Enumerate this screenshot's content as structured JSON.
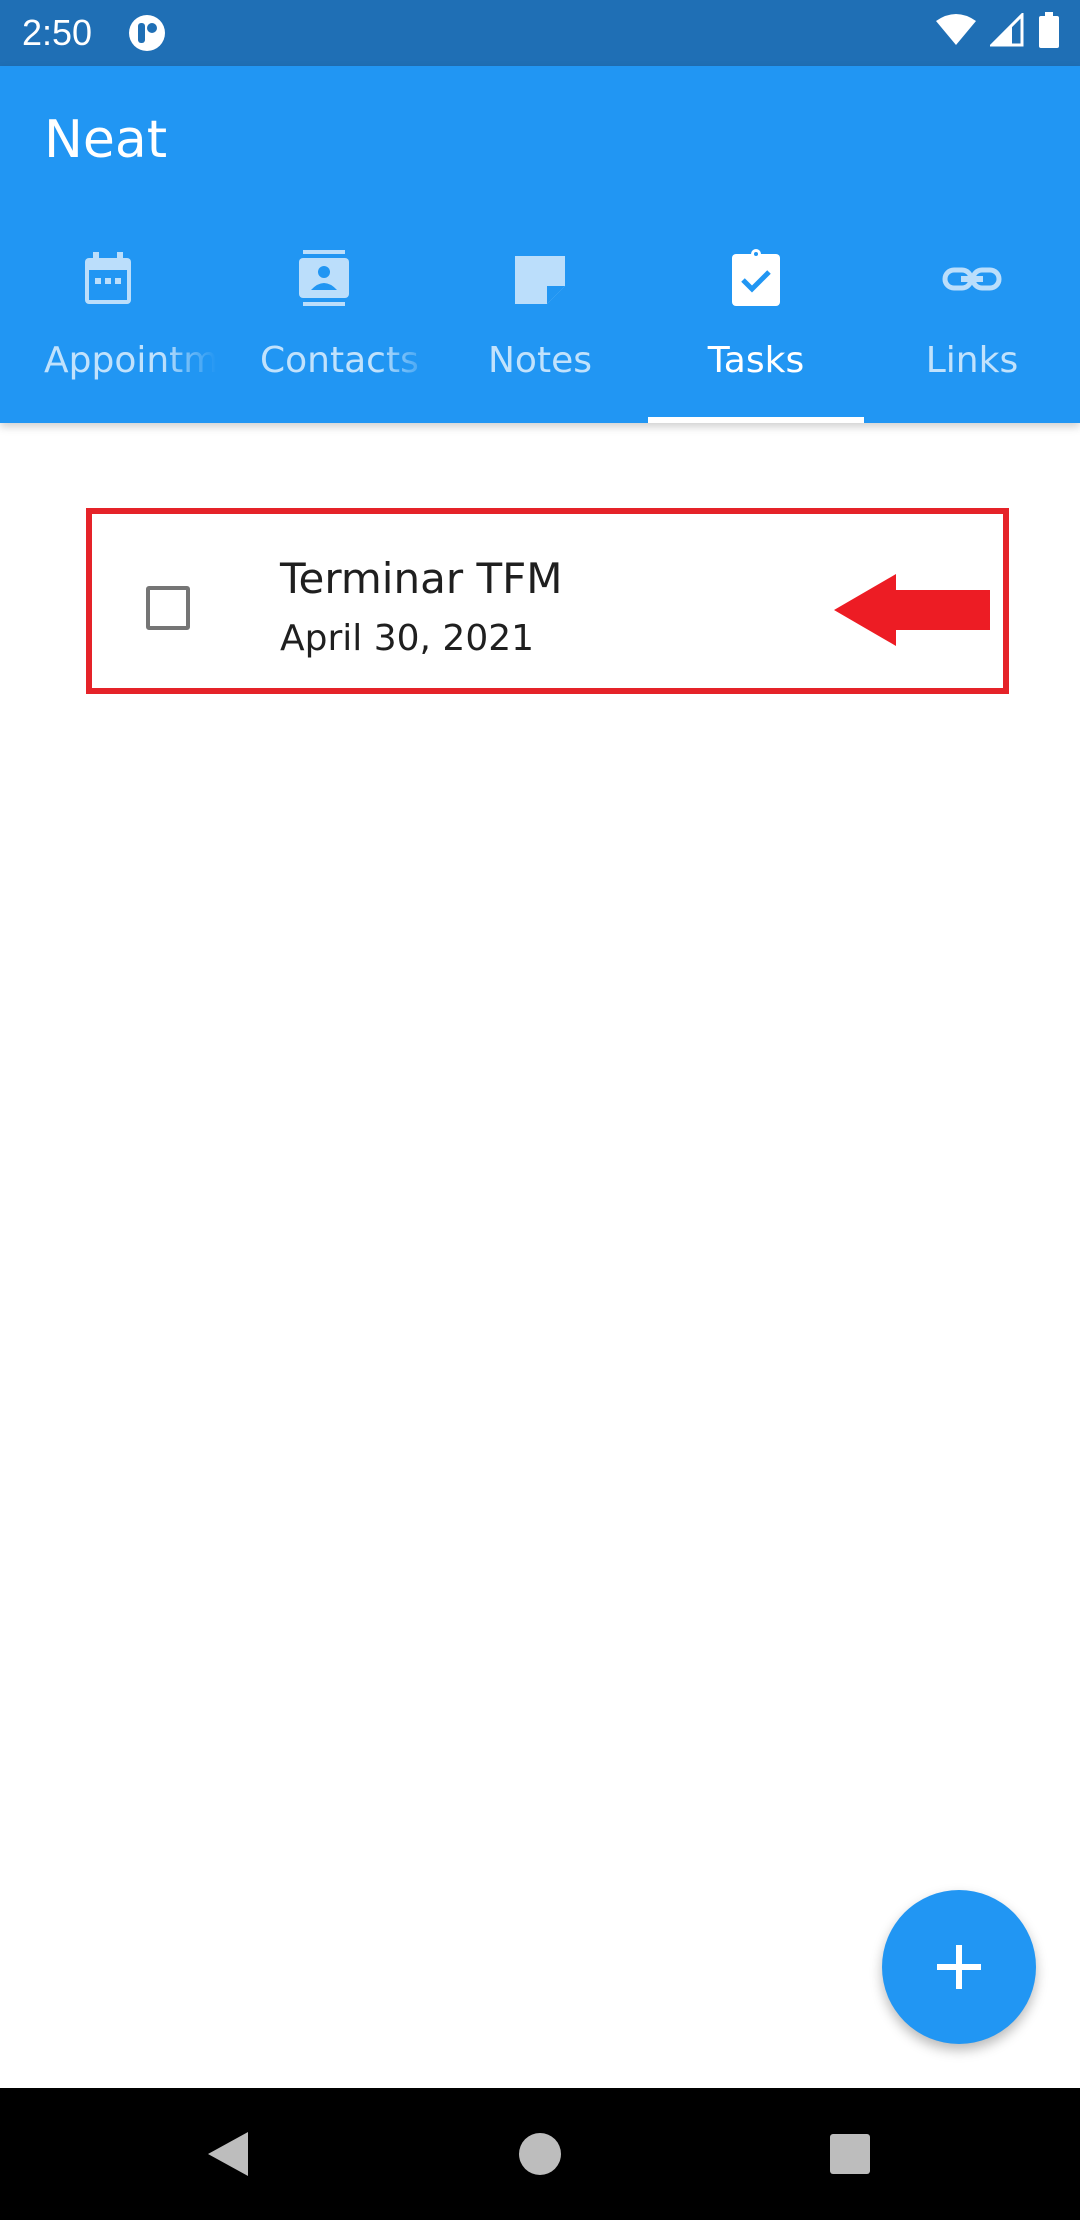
{
  "status_bar": {
    "time": "2:50",
    "icons": [
      "notification-app-icon",
      "wifi-icon",
      "signal-icon",
      "battery-icon"
    ]
  },
  "app_bar": {
    "title": "Neat",
    "color": "#2196f3"
  },
  "tabs": [
    {
      "label": "Appointments",
      "icon": "calendar-icon"
    },
    {
      "label": "Contacts",
      "icon": "contact-card-icon"
    },
    {
      "label": "Notes",
      "icon": "note-icon"
    },
    {
      "label": "Tasks",
      "icon": "clipboard-check-icon",
      "selected": true
    },
    {
      "label": "Links",
      "icon": "link-icon"
    }
  ],
  "tasks": [
    {
      "name": "Terminar TFM",
      "date": "April 30, 2021",
      "checked": false
    }
  ],
  "highlight": {
    "color": "#e52329",
    "marker": "arrow-left-icon"
  },
  "fab": {
    "icon": "plus-icon"
  },
  "nav_bar": {
    "icons": [
      "back-icon",
      "home-icon",
      "recents-icon"
    ]
  }
}
